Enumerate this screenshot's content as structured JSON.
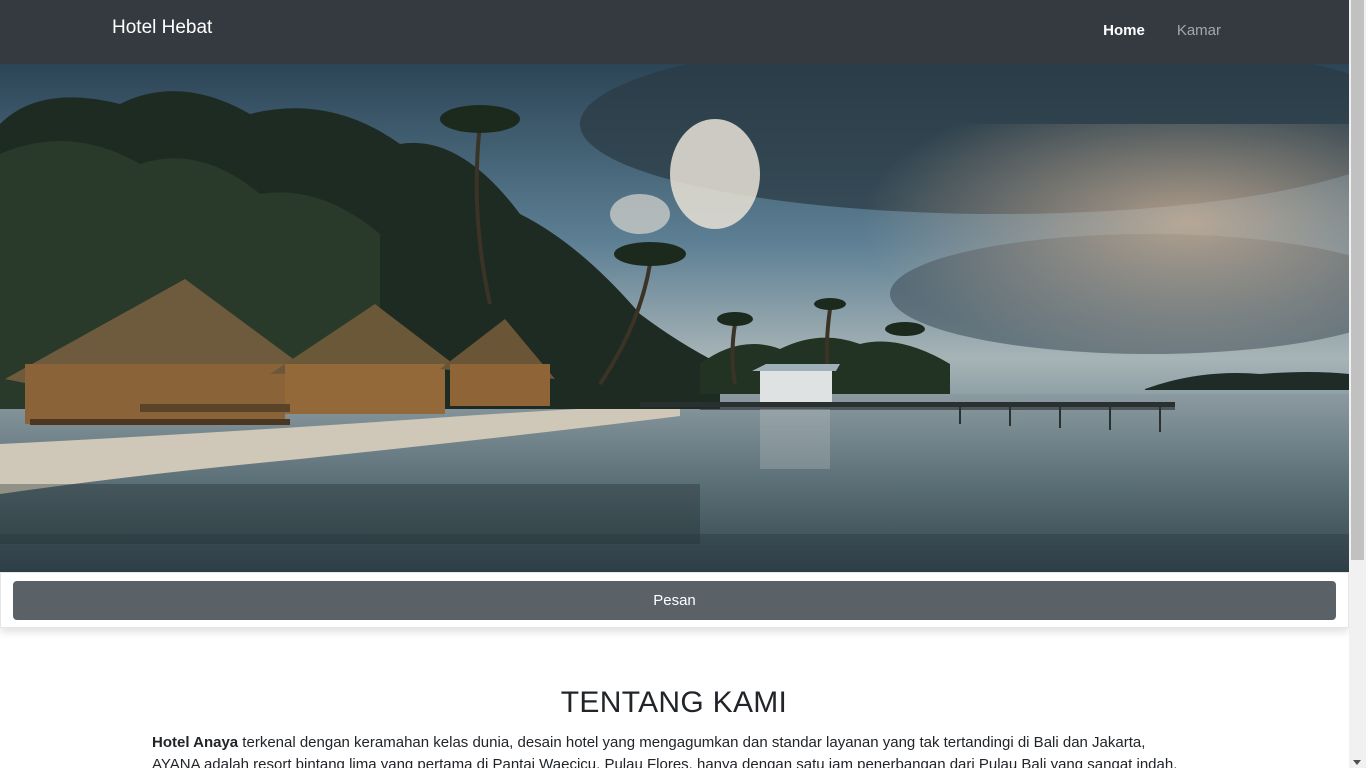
{
  "navbar": {
    "brand": "Hotel Hebat",
    "links": [
      {
        "label": "Home",
        "active": true
      },
      {
        "label": "Kamar",
        "active": false
      }
    ]
  },
  "hero": {
    "image_description_icon": "beach-resort-photo"
  },
  "order": {
    "button_label": "Pesan"
  },
  "about": {
    "title": "TENTANG KAMI",
    "hotel_name": "Hotel Anaya",
    "text": " terkenal dengan keramahan kelas dunia, desain hotel yang mengagumkan dan standar layanan yang tak tertandingi di Bali dan Jakarta, AYANA adalah resort bintang lima yang pertama di Pantai Waecicu, Pulau Flores, hanya dengan satu jam penerbangan dari Pulau Bali yang sangat indah. AYANA"
  },
  "colors": {
    "navbar_bg": "#343a40",
    "button_bg": "#5a6268"
  }
}
